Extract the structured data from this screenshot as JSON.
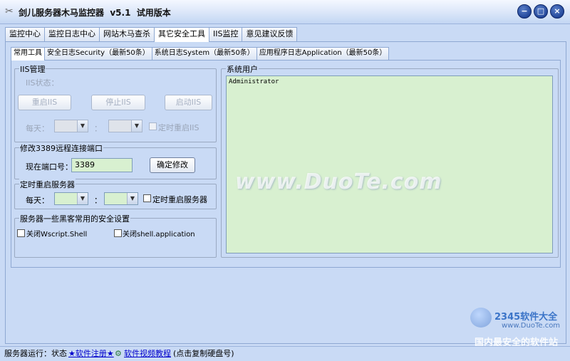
{
  "window": {
    "title": "剑儿服务器木马监控器  v5.1  试用版本",
    "buttons": {
      "minimize": "−",
      "maximize": "□",
      "close": "×"
    }
  },
  "main_tabs": [
    "监控中心",
    "监控日志中心",
    "网站木马查杀",
    "其它安全工具",
    "IIS监控",
    "意见建议反馈"
  ],
  "main_tab_active": 3,
  "sub_tabs": [
    "常用工具",
    "安全日志Security（最新50条）",
    "系统日志System（最新50条）",
    "应用程序日志Application（最新50条）"
  ],
  "sub_tab_active": 0,
  "iis": {
    "legend": "IIS管理",
    "status_label": "IIS状态：",
    "restart_label": "重启IIS",
    "stop_label": "停止IIS",
    "start_label": "启动IIS",
    "every_day_label": "每天：",
    "colon": "：",
    "timed_restart_label": "定时重启IIS"
  },
  "port": {
    "legend": "修改3389远程连接端口",
    "current_label": "现在端口号：",
    "current_value": "3389",
    "confirm_label": "确定修改"
  },
  "reboot": {
    "legend": "定时重启服务器",
    "every_day_label": "每天：",
    "colon": "：",
    "timed_label": "定时重启服务器"
  },
  "security": {
    "legend": "服务器一些黑客常用的安全设置",
    "wscript_label": "关闭Wscript.Shell",
    "shell_app_label": "关闭shell.application"
  },
  "system_users": {
    "legend": "系统用户",
    "items": [
      "Administrator"
    ]
  },
  "status": {
    "running_label": "服务器运行：",
    "state_label": "状态",
    "register_link": "★软件注册★",
    "video_link": "软件视频教程",
    "hint": "(点击复制硬盘号)"
  },
  "watermark": {
    "main": "www.DuoTe.com",
    "brand": "2345软件大全",
    "brand_url": "www.DuoTe.com",
    "slogan": "国内最安全的软件站"
  }
}
